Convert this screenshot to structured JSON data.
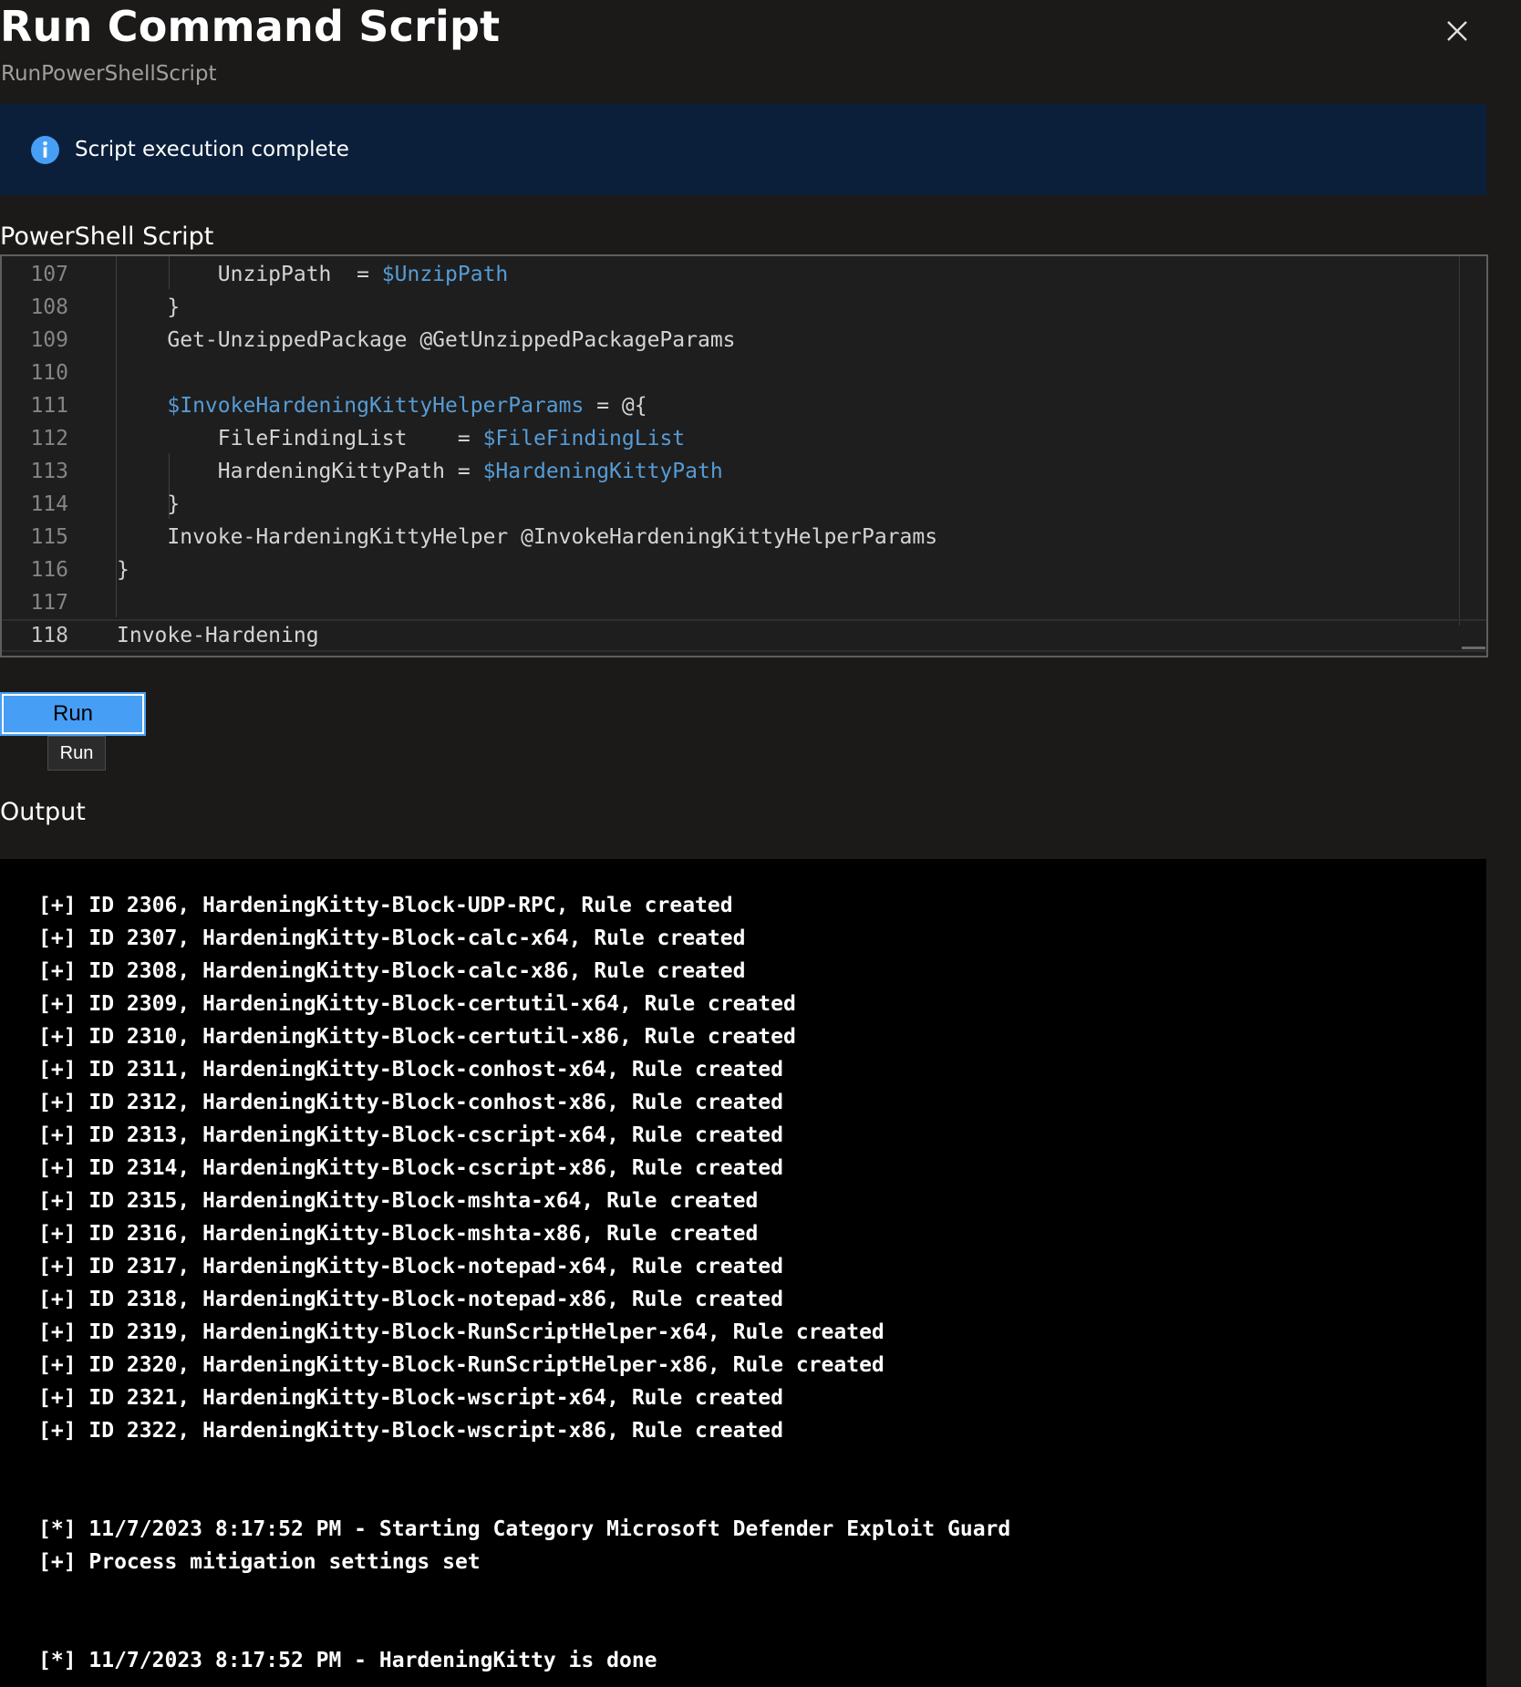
{
  "header": {
    "title": "Run Command Script",
    "subtitle": "RunPowerShellScript",
    "close_icon": "close-icon"
  },
  "info_bar": {
    "icon": "info-icon",
    "message": "Script execution complete"
  },
  "script_section": {
    "label": "PowerShell Script",
    "lines": [
      {
        "no": "107",
        "parts": [
          {
            "t": "        UnzipPath  = "
          },
          {
            "t": "$UnzipPath",
            "c": "var"
          }
        ]
      },
      {
        "no": "108",
        "parts": [
          {
            "t": "    }"
          }
        ]
      },
      {
        "no": "109",
        "parts": [
          {
            "t": "    Get-UnzippedPackage @GetUnzippedPackageParams"
          }
        ]
      },
      {
        "no": "110",
        "parts": [
          {
            "t": ""
          }
        ]
      },
      {
        "no": "111",
        "parts": [
          {
            "t": "    "
          },
          {
            "t": "$InvokeHardeningKittyHelperParams",
            "c": "var"
          },
          {
            "t": " = @{"
          }
        ]
      },
      {
        "no": "112",
        "parts": [
          {
            "t": "        FileFindingList    = "
          },
          {
            "t": "$FileFindingList",
            "c": "var"
          }
        ]
      },
      {
        "no": "113",
        "parts": [
          {
            "t": "        HardeningKittyPath = "
          },
          {
            "t": "$HardeningKittyPath",
            "c": "var"
          }
        ]
      },
      {
        "no": "114",
        "parts": [
          {
            "t": "    }"
          }
        ]
      },
      {
        "no": "115",
        "parts": [
          {
            "t": "    Invoke-HardeningKittyHelper @InvokeHardeningKittyHelperParams"
          }
        ]
      },
      {
        "no": "116",
        "parts": [
          {
            "t": "}"
          }
        ]
      },
      {
        "no": "117",
        "parts": [
          {
            "t": ""
          }
        ]
      },
      {
        "no": "118",
        "parts": [
          {
            "t": "Invoke-Hardening"
          }
        ],
        "current": true
      }
    ],
    "colors": {
      "variable": "#569cd6",
      "text": "#d4d4d4",
      "line_number": "#858585"
    }
  },
  "actions": {
    "run_label": "Run",
    "run_tooltip": "Run"
  },
  "output_section": {
    "label": "Output",
    "lines": [
      {
        "text": "[+] ID 2306, HardeningKitty-Block-UDP-RPC, Rule created"
      },
      {
        "text": "[+] ID 2307, HardeningKitty-Block-calc-x64, Rule created"
      },
      {
        "text": "[+] ID 2308, HardeningKitty-Block-calc-x86, Rule created"
      },
      {
        "text": "[+] ID 2309, HardeningKitty-Block-certutil-x64, Rule created"
      },
      {
        "text": "[+] ID 2310, HardeningKitty-Block-certutil-x86, Rule created"
      },
      {
        "text": "[+] ID 2311, HardeningKitty-Block-conhost-x64, Rule created"
      },
      {
        "text": "[+] ID 2312, HardeningKitty-Block-conhost-x86, Rule created"
      },
      {
        "text": "[+] ID 2313, HardeningKitty-Block-cscript-x64, Rule created"
      },
      {
        "text": "[+] ID 2314, HardeningKitty-Block-cscript-x86, Rule created"
      },
      {
        "text": "[+] ID 2315, HardeningKitty-Block-mshta-x64, Rule created"
      },
      {
        "text": "[+] ID 2316, HardeningKitty-Block-mshta-x86, Rule created"
      },
      {
        "text": "[+] ID 2317, HardeningKitty-Block-notepad-x64, Rule created"
      },
      {
        "text": "[+] ID 2318, HardeningKitty-Block-notepad-x86, Rule created"
      },
      {
        "text": "[+] ID 2319, HardeningKitty-Block-RunScriptHelper-x64, Rule created"
      },
      {
        "text": "[+] ID 2320, HardeningKitty-Block-RunScriptHelper-x86, Rule created"
      },
      {
        "text": "[+] ID 2321, HardeningKitty-Block-wscript-x64, Rule created"
      },
      {
        "text": "[+] ID 2322, HardeningKitty-Block-wscript-x86, Rule created"
      },
      {
        "text": ""
      },
      {
        "text": ""
      },
      {
        "text": "[*] 11/7/2023 8:17:52 PM - Starting Category Microsoft Defender Exploit Guard"
      },
      {
        "text": "[+] Process mitigation settings set"
      },
      {
        "text": ""
      },
      {
        "text": ""
      },
      {
        "text": "[*] 11/7/2023 8:17:52 PM - HardeningKitty is done"
      }
    ]
  }
}
